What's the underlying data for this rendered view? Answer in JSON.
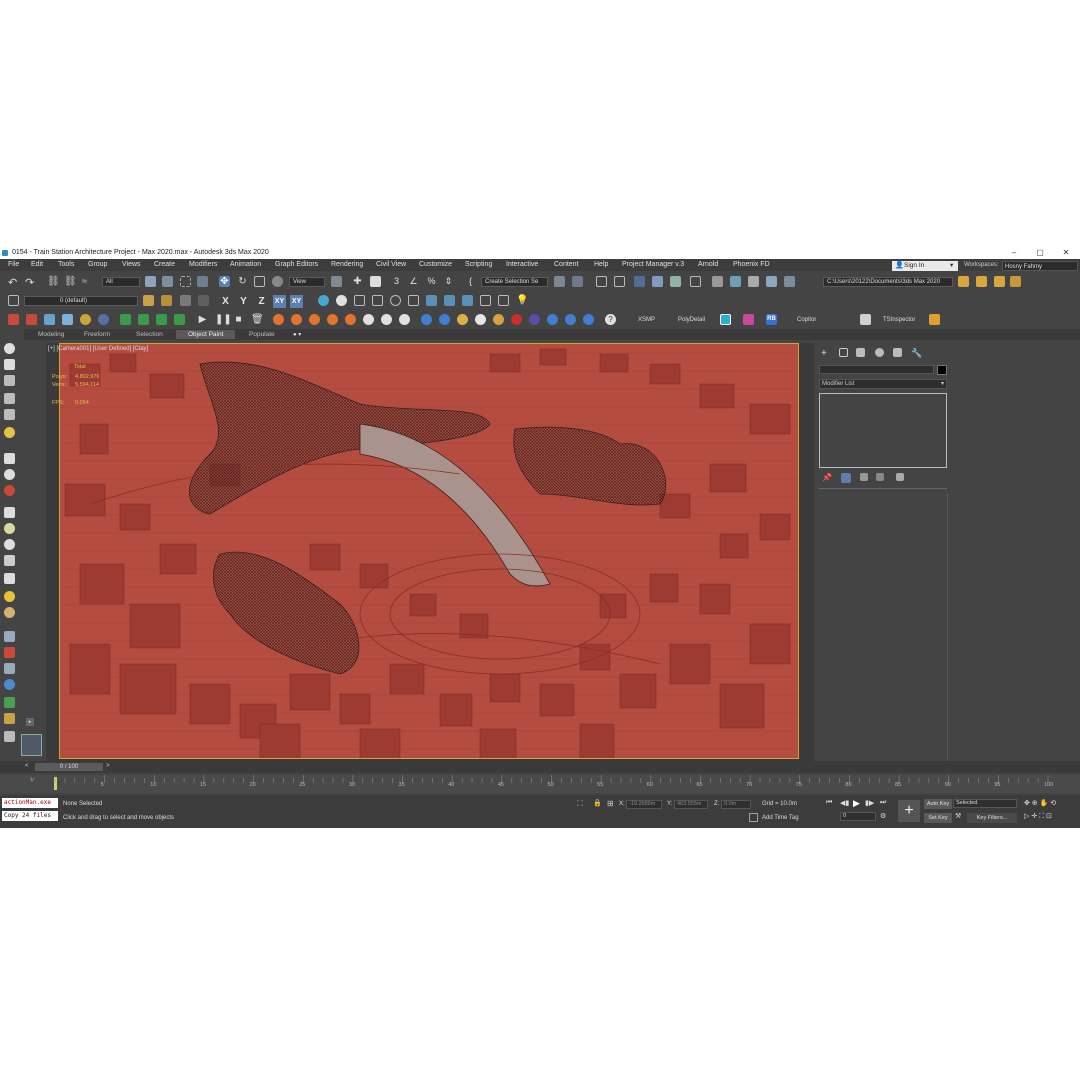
{
  "window": {
    "title": "0154 - Train Station Architecture Project - Max 2020.max - Autodesk 3ds Max 2020",
    "min": "–",
    "max": "▢",
    "close": "✕"
  },
  "menu": [
    "File",
    "Edit",
    "Tools",
    "Group",
    "Views",
    "Create",
    "Modifiers",
    "Animation",
    "Graph Editors",
    "Rendering",
    "Civil View",
    "Customize",
    "Scripting",
    "Interactive",
    "Content",
    "Help",
    "Project Manager v.3",
    "Arnold",
    "Phoenix FD"
  ],
  "signin": {
    "label": "Sign In",
    "chev": "▾"
  },
  "workspaces": {
    "label": "Workspaces:",
    "value": "Hosny Fahmy"
  },
  "toolbar": {
    "filter": "All",
    "view": "View",
    "selection_set": "Create Selection Se",
    "path": "C:\\Users\\20122\\Documents\\3ds Max 2020",
    "layer": "0 (default)",
    "xsmp": "XSMP",
    "polydetail": "PolyDetail",
    "rb": "RB",
    "copitor": "Copitor",
    "tsinspector": "TSInspector"
  },
  "axes": {
    "x": "X",
    "y": "Y",
    "z": "Z",
    "xy": "XY",
    "xy2": "XY"
  },
  "ribbon": [
    "Modeling",
    "Freeform",
    "Selection",
    "Object Paint",
    "Populate"
  ],
  "viewport": {
    "label": "[+] [Camera001] [User Defined] [Clay]",
    "total_label": "Total",
    "polys_label": "Polys:",
    "polys": "4,802,976",
    "verts_label": "Verts:",
    "verts": "5,594,114",
    "fps_label": "FPS:",
    "fps": "0.054"
  },
  "command_panel": {
    "modifier_list": "Modifier List"
  },
  "timeline": {
    "slider": "0 / 100",
    "prev": "<",
    "next": ">",
    "ticks": [
      "5",
      "10",
      "15",
      "20",
      "25",
      "30",
      "35",
      "40",
      "45",
      "50",
      "55",
      "60",
      "65",
      "70",
      "75",
      "80",
      "85",
      "90",
      "95",
      "100"
    ]
  },
  "status": {
    "maxscript1": "actionMan.exe",
    "maxscript2": "Copy 24 files",
    "selected": "None Selected",
    "prompt": "Click and drag to select and move objects",
    "x_label": "X:",
    "x_val": "-19.2689m",
    "y_label": "Y:",
    "y_val": "463.555m",
    "z_label": "Z:",
    "z_val": "0.0m",
    "grid": "Grid = 10.0m",
    "add_time_tag": "Add Time Tag",
    "auto_key": "Auto Key",
    "selected_set": "Selected",
    "set_key": "Set Key",
    "key_filters": "Key Filters...",
    "frame": "0"
  }
}
